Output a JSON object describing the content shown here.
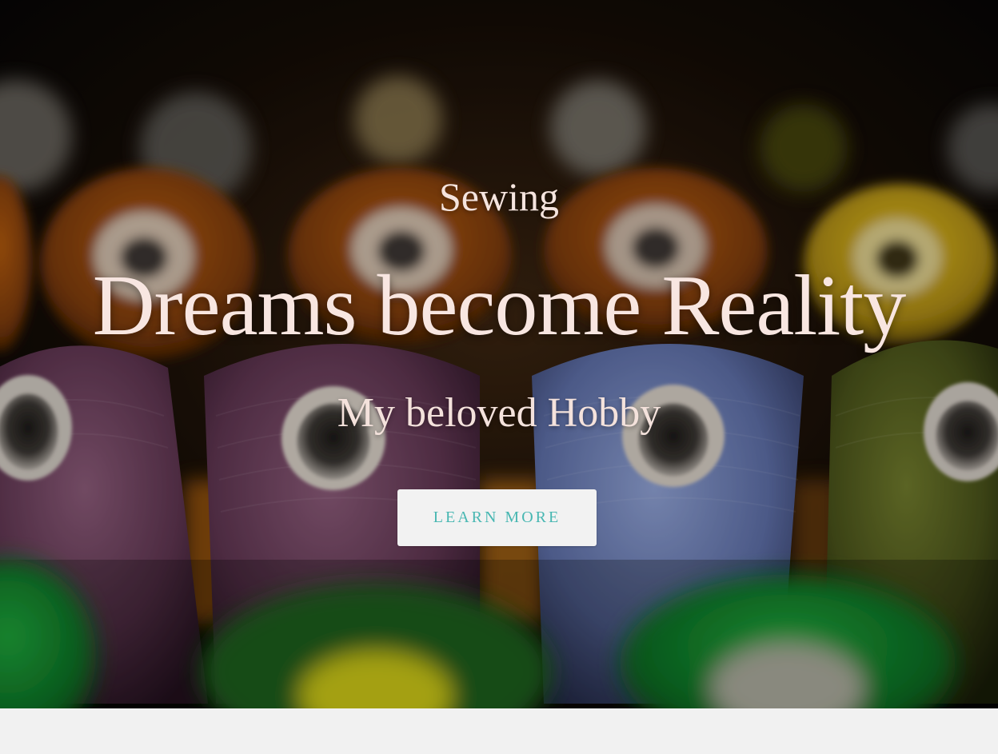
{
  "hero": {
    "eyebrow": "Sewing",
    "headline": "Dreams become Reality",
    "subheadline": "My beloved Hobby",
    "cta_label": "LEARN MORE",
    "background_image": "thread-spools-photo"
  },
  "colors": {
    "headline_text": "#f8e6e1",
    "cta_background": "#f2f2f2",
    "cta_text": "#48b7b2",
    "page_background": "#f1f1f1"
  }
}
